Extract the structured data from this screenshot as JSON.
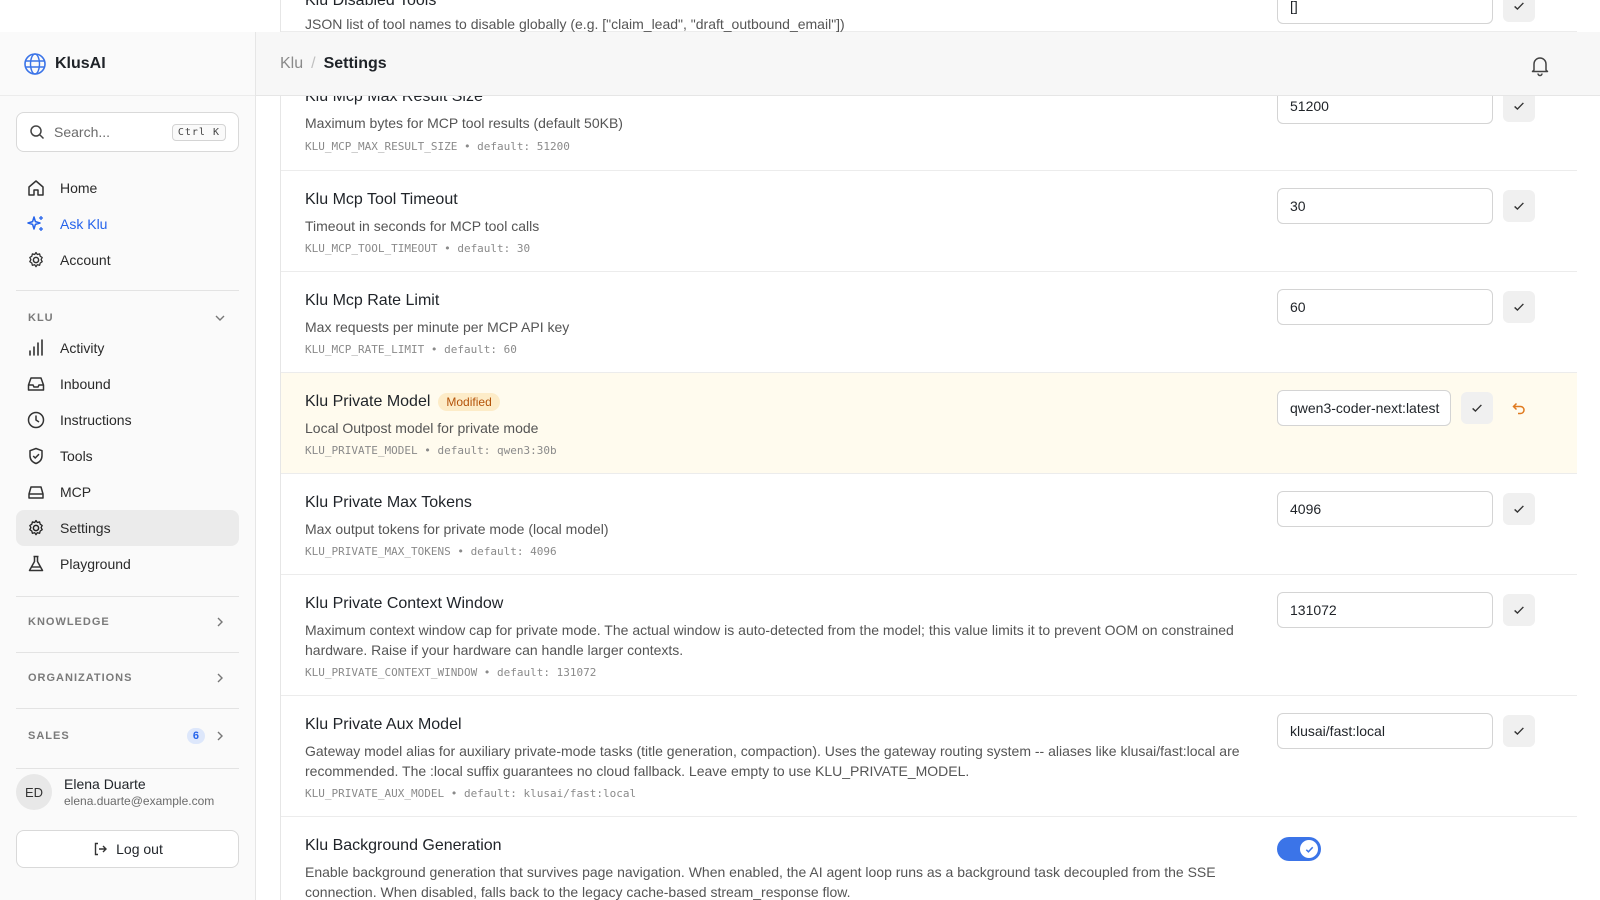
{
  "app": {
    "name": "KlusAI"
  },
  "search": {
    "placeholder": "Search...",
    "shortcut": "Ctrl K"
  },
  "nav_main": [
    {
      "label": "Home",
      "icon": "home-icon"
    },
    {
      "label": "Ask Klu",
      "icon": "sparkles-icon"
    },
    {
      "label": "Account",
      "icon": "gear-icon"
    }
  ],
  "section_klu": {
    "label": "KLU",
    "items": [
      {
        "label": "Activity",
        "icon": "bar-chart-icon"
      },
      {
        "label": "Inbound",
        "icon": "inbox-icon"
      },
      {
        "label": "Instructions",
        "icon": "clock-icon"
      },
      {
        "label": "Tools",
        "icon": "shield-check-icon"
      },
      {
        "label": "MCP",
        "icon": "drive-icon"
      },
      {
        "label": "Settings",
        "icon": "gear-icon"
      },
      {
        "label": "Playground",
        "icon": "flask-icon"
      }
    ]
  },
  "sections": {
    "knowledge": "KNOWLEDGE",
    "organizations": "ORGANIZATIONS",
    "sales": "SALES",
    "sales_count": "6"
  },
  "user": {
    "initials": "ED",
    "name": "Elena Duarte",
    "email": "elena.duarte@example.com"
  },
  "logout_label": "Log out",
  "breadcrumb": {
    "root": "Klu",
    "sep": "/",
    "current": "Settings"
  },
  "top_partial": {
    "title": "Klu Disabled Tools",
    "description": "JSON list of tool names to disable globally (e.g. [\"claim_lead\", \"draft_outbound_email\"])",
    "value": "[]"
  },
  "settings": [
    {
      "title": "Klu Mcp Max Result Size",
      "description": "Maximum bytes for MCP tool results (default 50KB)",
      "meta": "KLU_MCP_MAX_RESULT_SIZE • default: 51200",
      "value": "51200"
    },
    {
      "title": "Klu Mcp Tool Timeout",
      "description": "Timeout in seconds for MCP tool calls",
      "meta": "KLU_MCP_TOOL_TIMEOUT • default: 30",
      "value": "30"
    },
    {
      "title": "Klu Mcp Rate Limit",
      "description": "Max requests per minute per MCP API key",
      "meta": "KLU_MCP_RATE_LIMIT • default: 60",
      "value": "60"
    },
    {
      "title": "Klu Private Model",
      "badge": "Modified",
      "description": "Local Outpost model for private mode",
      "meta": "KLU_PRIVATE_MODEL • default: qwen3:30b",
      "value": "qwen3-coder-next:latest"
    },
    {
      "title": "Klu Private Max Tokens",
      "description": "Max output tokens for private mode (local model)",
      "meta": "KLU_PRIVATE_MAX_TOKENS • default: 4096",
      "value": "4096"
    },
    {
      "title": "Klu Private Context Window",
      "description": "Maximum context window cap for private mode. The actual window is auto-detected from the model; this value limits it to prevent OOM on constrained hardware. Raise if your hardware can handle larger contexts.",
      "meta": "KLU_PRIVATE_CONTEXT_WINDOW • default: 131072",
      "value": "131072"
    },
    {
      "title": "Klu Private Aux Model",
      "description": "Gateway model alias for auxiliary private-mode tasks (title generation, compaction). Uses the gateway routing system -- aliases like klusai/fast:local are recommended. The :local suffix guarantees no cloud fallback. Leave empty to use KLU_PRIVATE_MODEL.",
      "meta": "KLU_PRIVATE_AUX_MODEL • default: klusai/fast:local",
      "value": "klusai/fast:local"
    },
    {
      "title": "Klu Background Generation",
      "description": "Enable background generation that survives page navigation. When enabled, the AI agent loop runs as a background task decoupled from the SSE connection. When disabled, falls back to the legacy cache-based stream_response flow.",
      "toggle": true
    }
  ],
  "colors": {
    "accent": "#2563eb",
    "modified_bg": "#fffbee",
    "modified_badge": "#b45309",
    "toggle_on": "#3b74e8"
  }
}
